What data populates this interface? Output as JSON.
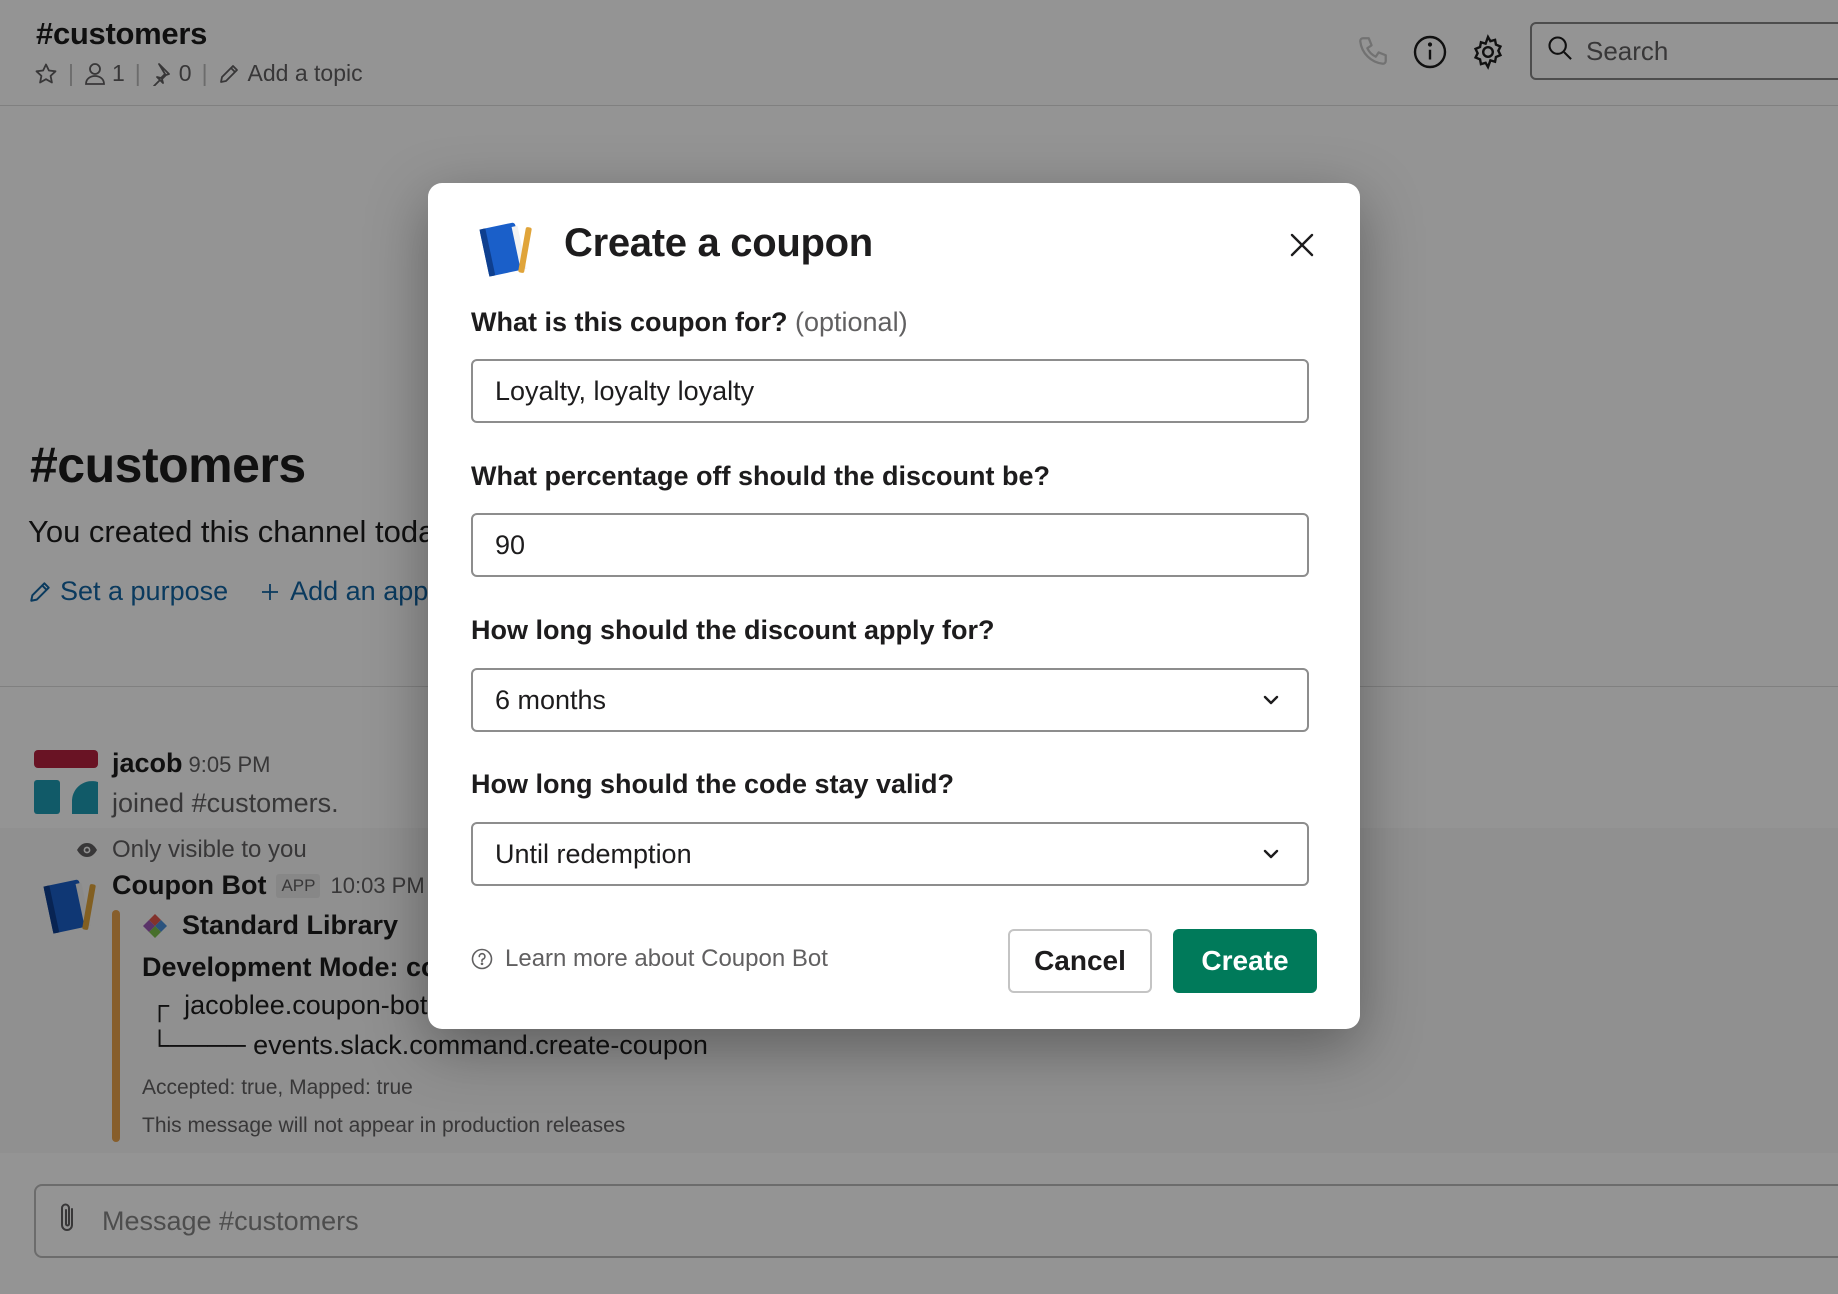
{
  "header": {
    "channel_title": "#customers",
    "member_count": "1",
    "pin_count": "0",
    "topic_link": "Add a topic",
    "search_placeholder": "Search"
  },
  "intro": {
    "title": "#customers",
    "description": "You created this channel today",
    "actions": [
      "Set a purpose",
      "Add an app"
    ]
  },
  "messages": [
    {
      "author": "jacob",
      "time": "9:05 PM",
      "body": "joined #customers."
    },
    {
      "visibility_note": "Only visible to you",
      "author": "Coupon Bot",
      "badge": "APP",
      "time": "10:03 PM",
      "attachment": {
        "library": "Standard Library",
        "dev_mode": "Development Mode: connected",
        "tree_line1": "jacoblee.coupon-bot[@dev]",
        "tree_line2": "events.slack.command.create-coupon",
        "accepted": "Accepted: true, Mapped: true",
        "note": "This message will not appear in production releases"
      }
    }
  ],
  "composer": {
    "placeholder": "Message #customers"
  },
  "modal": {
    "title": "Create a coupon",
    "fields": [
      {
        "label": "What is this coupon for?",
        "optional": "(optional)",
        "value": "Loyalty, loyalty loyalty"
      },
      {
        "label": "What percentage off should the discount be?",
        "value": "90"
      },
      {
        "label": "How long should the discount apply for?",
        "value": "6 months"
      },
      {
        "label": "How long should the code stay valid?",
        "value": "Until redemption"
      }
    ],
    "learn_more": "Learn more about Coupon Bot",
    "cancel_label": "Cancel",
    "create_label": "Create"
  },
  "colors": {
    "primary_button": "#007a5a",
    "link": "#1264a3",
    "attachment_bar": "#e8a24a",
    "jacob_avatar_top": "#b5223f",
    "jacob_avatar_bottom": "#1e9bb3"
  }
}
